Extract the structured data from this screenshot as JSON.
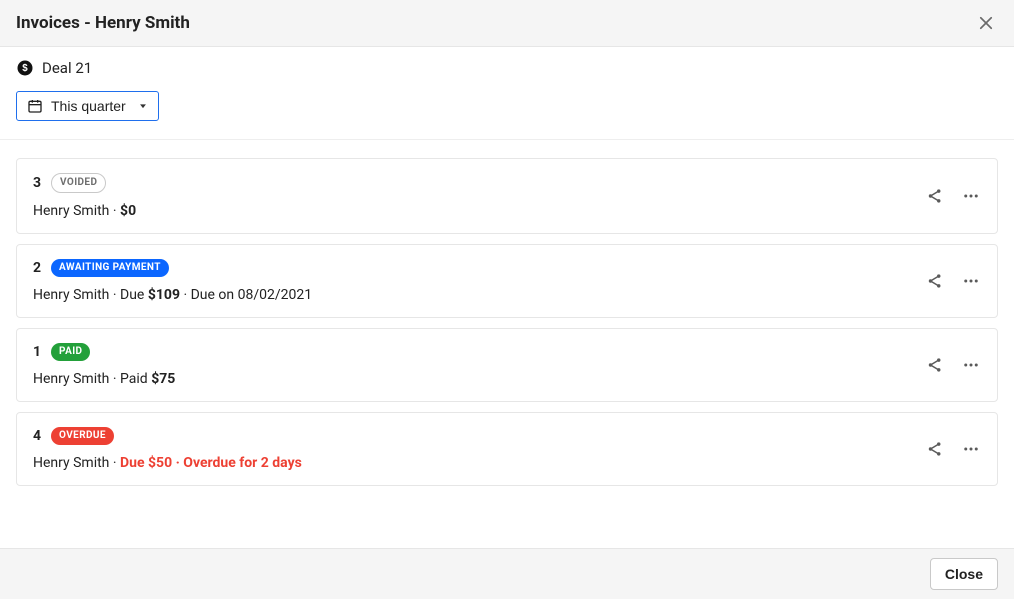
{
  "header": {
    "title": "Invoices - Henry Smith"
  },
  "deal": {
    "label": "Deal 21"
  },
  "period": {
    "label": "This quarter"
  },
  "invoices": [
    {
      "number": "3",
      "status_label": "VOIDED",
      "status_kind": "voided",
      "customer": "Henry Smith",
      "amount": "$0",
      "detail_prefix": "",
      "detail_suffix": "",
      "danger": false
    },
    {
      "number": "2",
      "status_label": "AWAITING PAYMENT",
      "status_kind": "awaiting",
      "customer": "Henry Smith",
      "amount": "$109",
      "detail_prefix": "Due ",
      "detail_suffix": " · Due on 08/02/2021",
      "danger": false
    },
    {
      "number": "1",
      "status_label": "PAID",
      "status_kind": "paid",
      "customer": "Henry Smith",
      "amount": "$75",
      "detail_prefix": "Paid ",
      "detail_suffix": "",
      "danger": false
    },
    {
      "number": "4",
      "status_label": "OVERDUE",
      "status_kind": "overdue",
      "customer": "Henry Smith",
      "amount": "Due $50",
      "detail_prefix": "",
      "detail_suffix": " · Overdue for 2 days",
      "danger": true
    }
  ],
  "footer": {
    "close_label": "Close"
  }
}
